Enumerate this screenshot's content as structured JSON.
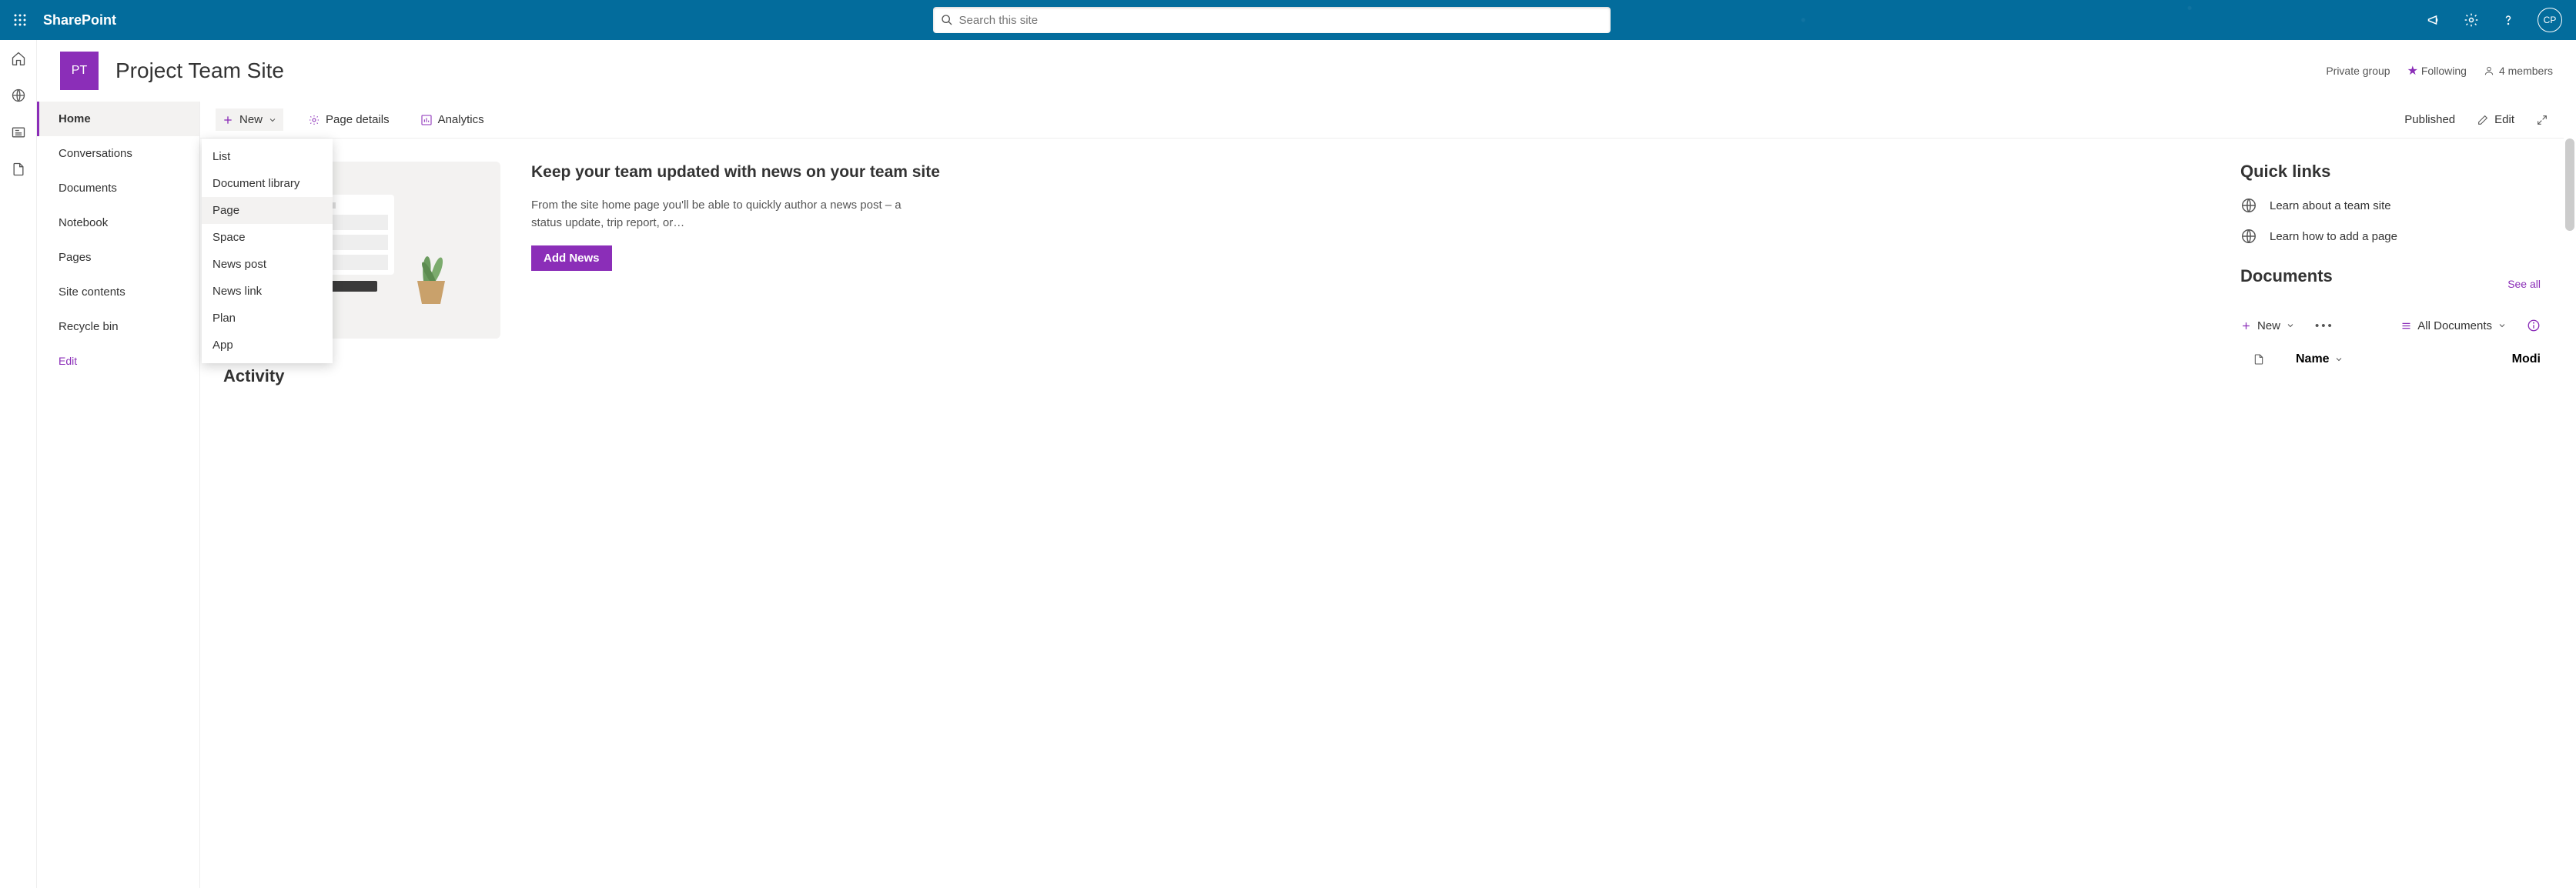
{
  "suite": {
    "brand": "SharePoint",
    "search_placeholder": "Search this site",
    "avatar_initials": "CP"
  },
  "site": {
    "logo_initials": "PT",
    "title": "Project Team Site",
    "privacy": "Private group",
    "following": "Following",
    "members": "4 members"
  },
  "leftnav": {
    "items": [
      "Home",
      "Conversations",
      "Documents",
      "Notebook",
      "Pages",
      "Site contents",
      "Recycle bin"
    ],
    "active_index": 0,
    "edit": "Edit"
  },
  "cmdbar": {
    "new": "New",
    "page_details": "Page details",
    "analytics": "Analytics",
    "published": "Published",
    "edit": "Edit"
  },
  "new_menu": {
    "items": [
      "List",
      "Document library",
      "Page",
      "Space",
      "News post",
      "News link",
      "Plan",
      "App"
    ],
    "hover_index": 2
  },
  "news": {
    "heading": "Keep your team updated with news on your team site",
    "body": "From the site home page you'll be able to quickly author a news post – a status update, trip report, or…",
    "button": "Add News"
  },
  "activity_heading": "Activity",
  "quicklinks": {
    "heading": "Quick links",
    "items": [
      "Learn about a team site",
      "Learn how to add a page"
    ]
  },
  "documents": {
    "heading": "Documents",
    "see_all": "See all",
    "new": "New",
    "all_documents": "All Documents",
    "col_name": "Name",
    "col_modified": "Modi"
  }
}
